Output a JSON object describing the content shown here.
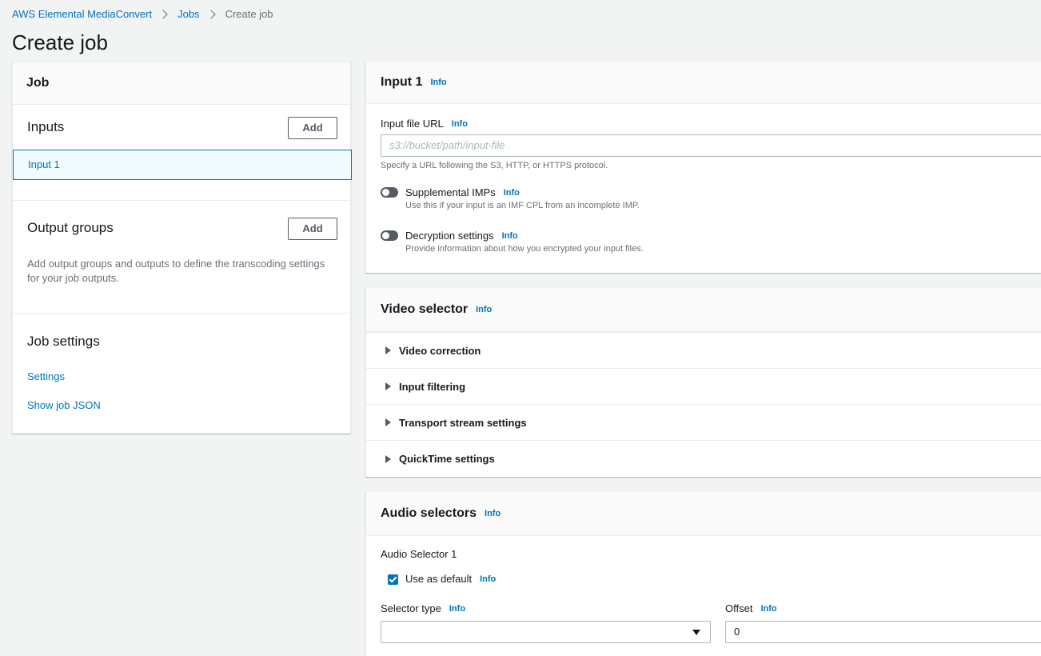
{
  "breadcrumb": {
    "items": [
      "AWS Elemental MediaConvert",
      "Jobs"
    ],
    "current": "Create job"
  },
  "page_title": "Create job",
  "left_panel": {
    "header": "Job",
    "inputs": {
      "title": "Inputs",
      "add_label": "Add",
      "items": [
        "Input 1"
      ]
    },
    "output_groups": {
      "title": "Output groups",
      "add_label": "Add",
      "description": "Add output groups and outputs to define the transcoding settings for your job outputs."
    },
    "job_settings": {
      "title": "Job settings",
      "links": [
        "Settings",
        "Show job JSON"
      ]
    }
  },
  "info_label": "Info",
  "input_card": {
    "title": "Input 1",
    "file_url_label": "Input file URL",
    "file_url_placeholder": "s3://bucket/path/input-file",
    "file_url_hint": "Specify a URL following the S3, HTTP, or HTTPS protocol.",
    "supplemental": {
      "label": "Supplemental IMPs",
      "hint": "Use this if your input is an IMF CPL from an incomplete IMP.",
      "enabled": false
    },
    "decryption": {
      "label": "Decryption settings",
      "hint": "Provide information about how you encrypted your input files.",
      "enabled": false
    }
  },
  "video_selector": {
    "title": "Video selector",
    "sections": [
      "Video correction",
      "Input filtering",
      "Transport stream settings",
      "QuickTime settings"
    ]
  },
  "audio_selectors": {
    "title": "Audio selectors",
    "selector_name": "Audio Selector 1",
    "use_default_label": "Use as default",
    "use_default_checked": true,
    "selector_type_label": "Selector type",
    "selector_type_value": "",
    "offset_label": "Offset",
    "offset_value": "0"
  },
  "colors": {
    "link": "#0073bb",
    "background": "#f2f3f3",
    "button_border": "#545b64"
  }
}
